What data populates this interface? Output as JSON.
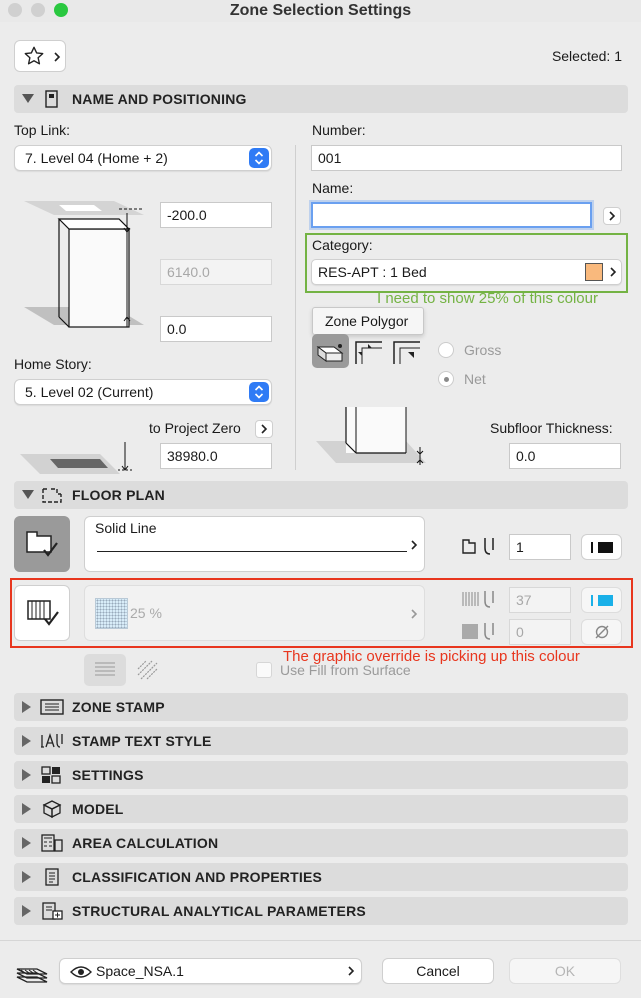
{
  "window": {
    "title": "Zone Selection Settings"
  },
  "header": {
    "selected_label": "Selected: 1"
  },
  "sections": {
    "name_positioning": "NAME AND POSITIONING",
    "floor_plan": "FLOOR PLAN",
    "zone_stamp": "ZONE STAMP",
    "stamp_text_style": "STAMP TEXT STYLE",
    "settings": "SETTINGS",
    "model": "MODEL",
    "area_calculation": "AREA CALCULATION",
    "classification": "CLASSIFICATION AND PROPERTIES",
    "structural": "STRUCTURAL ANALYTICAL PARAMETERS"
  },
  "positioning": {
    "top_link_label": "Top Link:",
    "top_link_value": "7. Level 04 (Home + 2)",
    "offset_top": "-200.0",
    "height": "6140.0",
    "offset_bottom": "0.0",
    "home_story_label": "Home Story:",
    "home_story_value": "5. Level 02 (Current)",
    "project_zero_label": "to Project Zero",
    "project_zero_value": "38980.0"
  },
  "identity": {
    "number_label": "Number:",
    "number_value": "001",
    "name_label": "Name:",
    "name_value": "",
    "category_label": "Category:",
    "category_value": "RES-APT :  1 Bed",
    "category_color": "#f9b97d"
  },
  "geometry": {
    "tooltip": "Zone Polygor",
    "gross_label": "Gross",
    "net_label": "Net",
    "subfloor_label": "Subfloor Thickness:",
    "subfloor_value": "0.0"
  },
  "floor_plan": {
    "line_type": "Solid Line",
    "pen_value": "1",
    "fill_percent": "25 %",
    "fill_pen": "37",
    "bg_pen": "0",
    "use_fill_label": "Use Fill from Surface"
  },
  "annotations": {
    "green_note": "I need to show 25% of this colour",
    "red_note": "The graphic override is picking up this colour"
  },
  "footer": {
    "layer": "Space_NSA.1",
    "cancel": "Cancel",
    "ok": "OK"
  },
  "colors": {
    "accent": "#2f7bf5",
    "annotation_green": "#74b344",
    "annotation_red": "#e8361e",
    "cyan_swatch": "#1ab0e8"
  }
}
